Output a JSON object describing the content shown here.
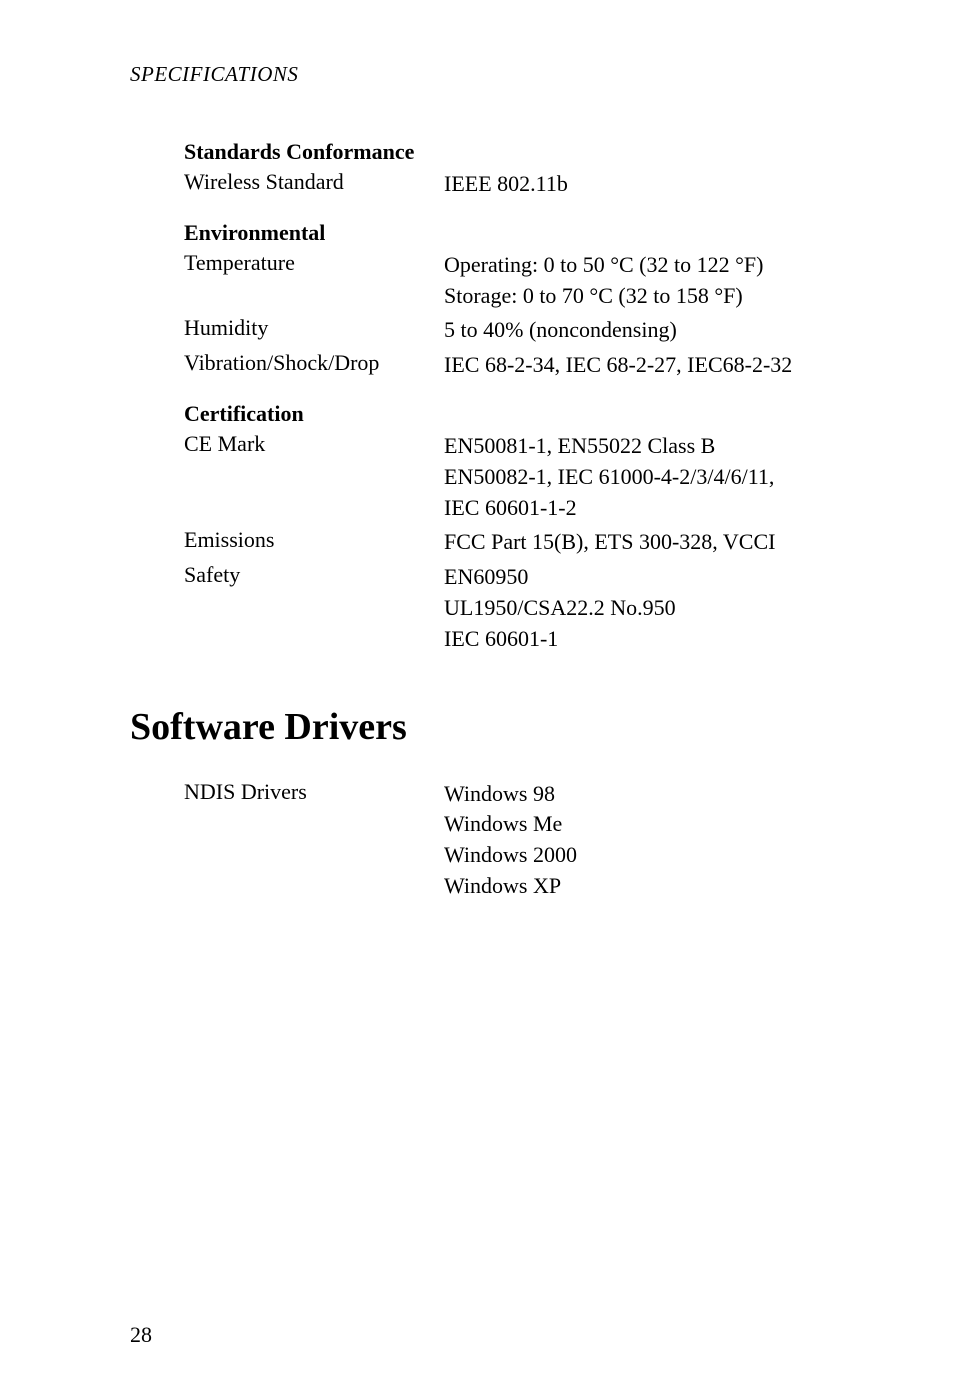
{
  "runningHead": "SPECIFICATIONS",
  "sections": {
    "standards": {
      "heading": "Standards Conformance",
      "rows": {
        "wireless": {
          "label": "Wireless Standard",
          "value": "IEEE 802.11b"
        }
      }
    },
    "environmental": {
      "heading": "Environmental",
      "rows": {
        "tempLabel": "Temperature",
        "tempL1": "Operating: 0 to 50 °C (32 to 122 °F)",
        "tempL2": "Storage: 0 to 70 °C (32 to 158 °F)",
        "humidity": {
          "label": "Humidity",
          "value": "5 to 40% (noncondensing)"
        },
        "vibration": {
          "label": "Vibration/Shock/Drop",
          "value": "IEC 68-2-34, IEC 68-2-27, IEC68-2-32"
        }
      }
    },
    "certification": {
      "heading": "Certification",
      "rows": {
        "ceLabel": "CE Mark",
        "ceL1": "EN50081-1, EN55022 Class B",
        "ceL2": "EN50082-1, IEC  61000-4-2/3/4/6/11,",
        "ceL3": "IEC 60601-1-2",
        "emissions": {
          "label": "Emissions",
          "value": "FCC Part 15(B), ETS 300-328, VCCI"
        },
        "safetyLabel": "Safety",
        "safetyL1": "EN60950",
        "safetyL2": "UL1950/CSA22.2 No.950",
        "safetyL3": "IEC 60601-1"
      }
    }
  },
  "softwareHeading": "Software Drivers",
  "software": {
    "ndisLabel": "NDIS Drivers",
    "ndisL1": "Windows 98",
    "ndisL2": "Windows Me",
    "ndisL3": "Windows 2000",
    "ndisL4": "Windows XP"
  },
  "pageNumber": "28"
}
